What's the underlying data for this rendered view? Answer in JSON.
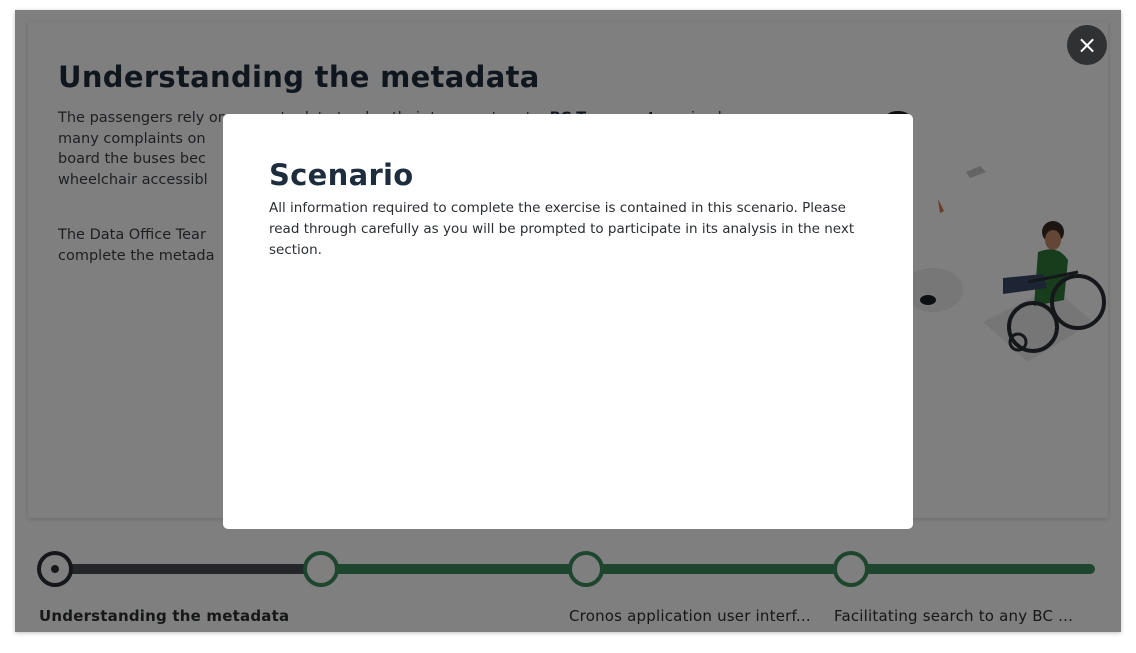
{
  "lesson": {
    "title": "Understanding the metadata",
    "para1_start": "The passengers rely on accurate data to plan their transport route. ",
    "para1_bold": "BC Transport",
    "para1_end": " received many complaints on ... board the buses bec... wheelchair accessibl...",
    "para1_line1": "The passengers rely on accurate data to plan their transport route. ",
    "para1_line1_after": " received",
    "para1_line2": "many complaints on",
    "para1_line3": "board the buses bec",
    "para1_line4": "wheelchair accessibl",
    "para2_line1": "The Data Office Tear",
    "para2_line2": "complete the metada"
  },
  "stepper": {
    "steps": [
      {
        "label": "Understanding the metadata",
        "active": true
      },
      {
        "label": "",
        "active": false
      },
      {
        "label": "Cronos application user interf...",
        "active": false
      },
      {
        "label": "Facilitating search to any BC ...",
        "active": false
      }
    ]
  },
  "modal": {
    "title": "Scenario",
    "text": "All information required to complete the exercise is contained in this scenario. Please read through carefully as you will be prompted to participate in its analysis in the next section."
  },
  "close_icon": "×",
  "colors": {
    "primary_dark": "#1e2d3d",
    "step_green": "#3d8a5c",
    "step_dark": "#2b2f36",
    "track_dark": "#4a4d52",
    "overlay": "rgba(0,0,0,0.5)"
  }
}
